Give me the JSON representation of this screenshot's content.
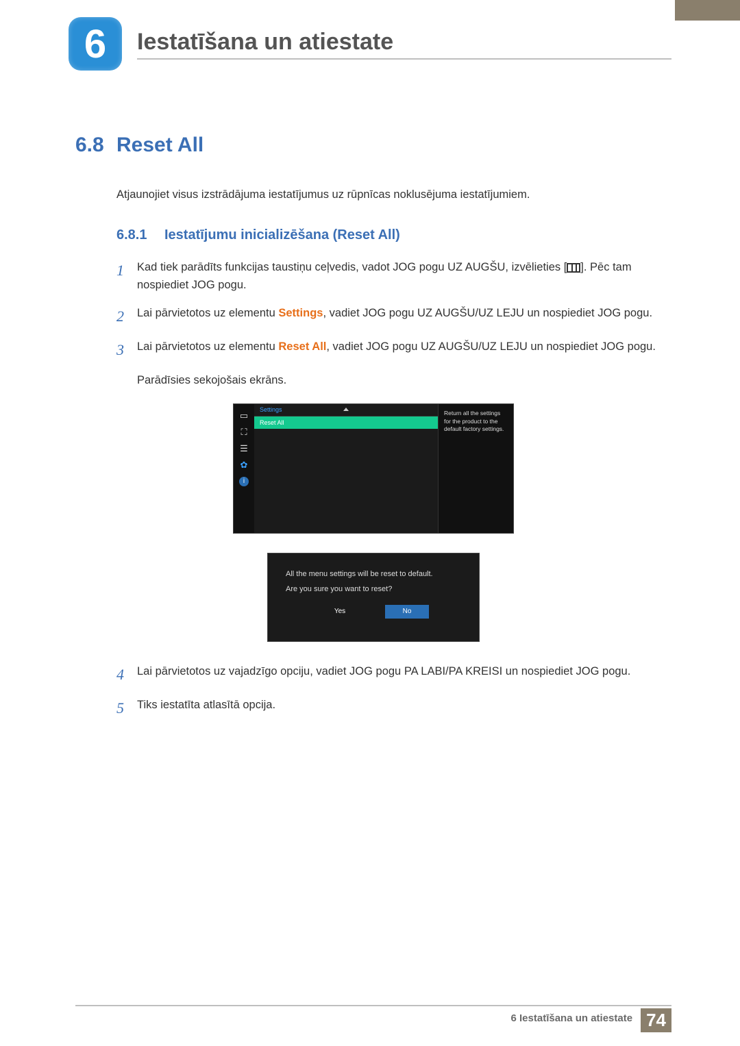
{
  "chapter": {
    "number": "6",
    "title": "Iestatīšana un atiestate"
  },
  "section": {
    "number": "6.8",
    "title": "Reset All"
  },
  "intro": "Atjaunojiet visus izstrādājuma iestatījumus uz rūpnīcas noklusējuma iestatījumiem.",
  "subsection": {
    "number": "6.8.1",
    "title": "Iestatījumu inicializēšana (Reset All)"
  },
  "steps": {
    "s1": {
      "num": "1",
      "text_a": "Kad tiek parādīts funkcijas taustiņu ceļvedis, vadot JOG pogu UZ AUGŠU, izvēlieties [",
      "text_b": "]. Pēc tam nospiediet JOG pogu."
    },
    "s2": {
      "num": "2",
      "text_a": "Lai pārvietotos uz elementu ",
      "bold": "Settings",
      "text_b": ", vadiet JOG pogu UZ AUGŠU/UZ LEJU un nospiediet JOG pogu."
    },
    "s3": {
      "num": "3",
      "text_a": "Lai pārvietotos uz elementu ",
      "bold": "Reset All",
      "text_b": ", vadiet JOG pogu UZ AUGŠU/UZ LEJU un nospiediet JOG pogu."
    },
    "s3_sub": "Parādīsies sekojošais ekrāns.",
    "s4": {
      "num": "4",
      "text": "Lai pārvietotos uz vajadzīgo opciju, vadiet JOG pogu PA LABI/PA KREISI un nospiediet JOG pogu."
    },
    "s5": {
      "num": "5",
      "text": "Tiks iestatīta atlasītā opcija."
    }
  },
  "osd1": {
    "title": "Settings",
    "selected": "Reset All",
    "help": "Return all the settings for the product to the default factory settings."
  },
  "osd2": {
    "line1": "All the menu settings will be reset to default.",
    "line2": "Are you sure you want to reset?",
    "yes": "Yes",
    "no": "No"
  },
  "footer": {
    "chapter_ref": "6 Iestatīšana un atiestate",
    "page": "74"
  }
}
